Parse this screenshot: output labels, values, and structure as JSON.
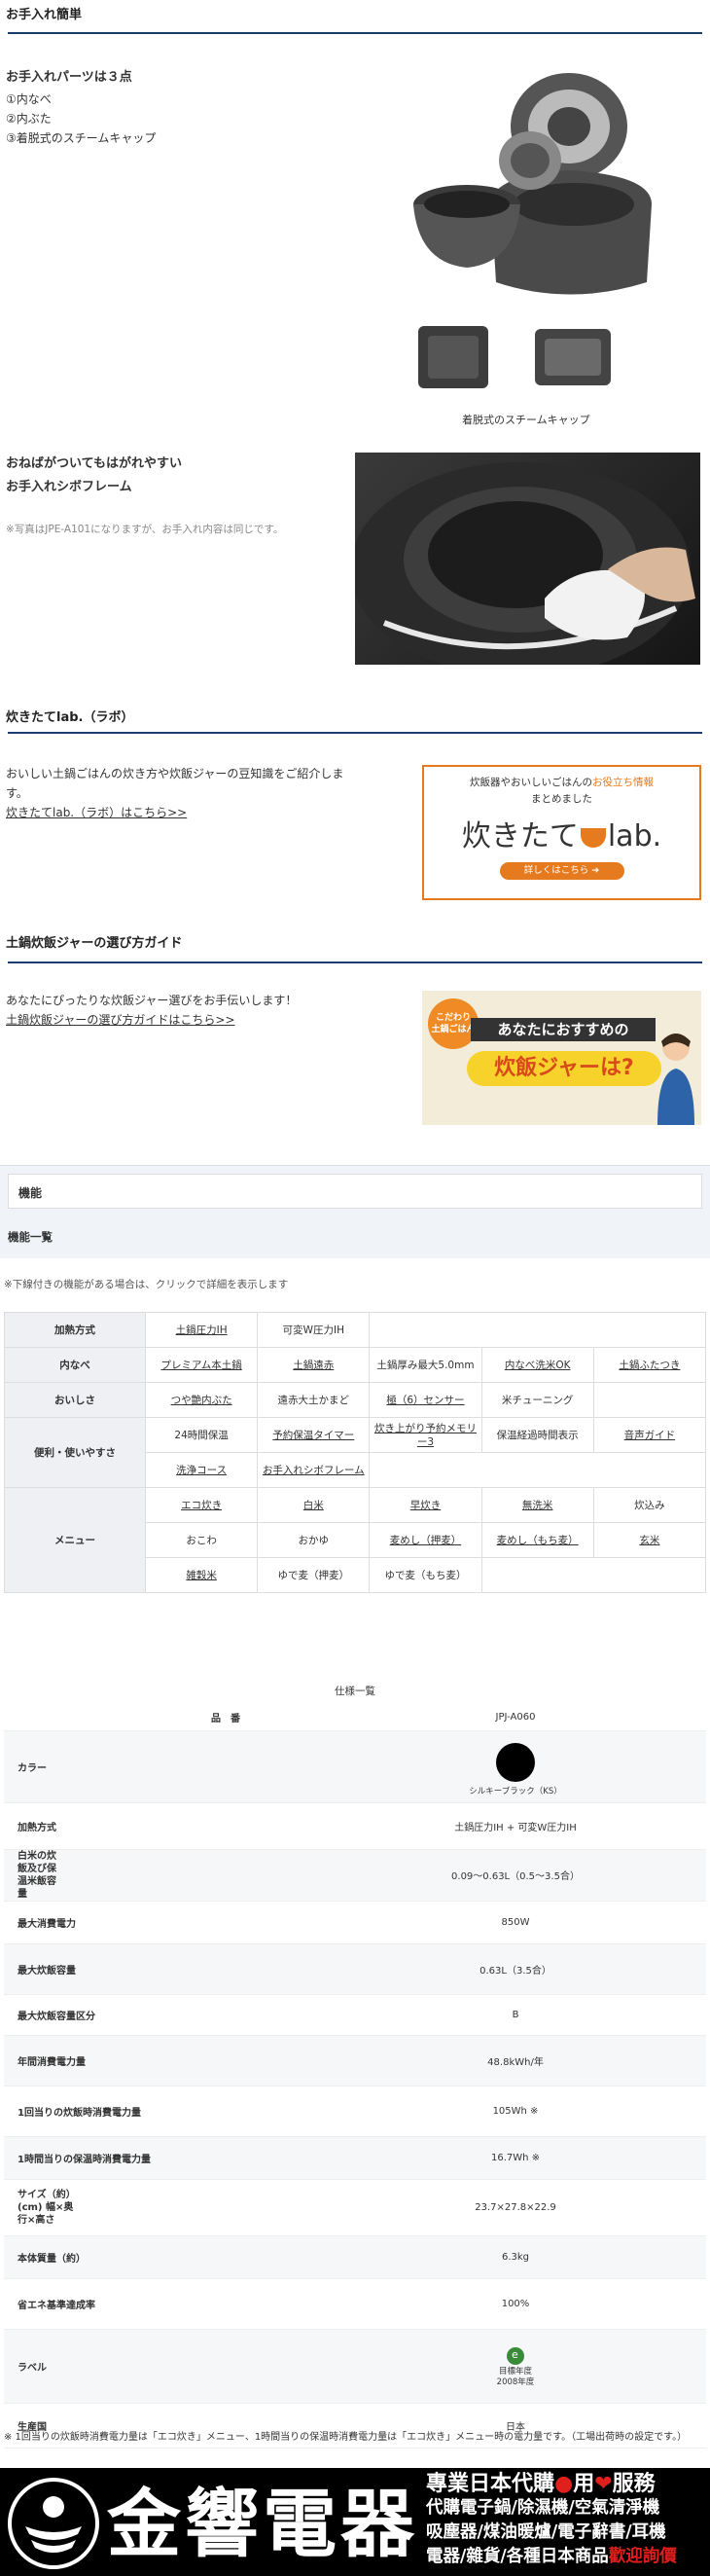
{
  "section1": {
    "title": "お手入れ簡単",
    "parts_head": "お手入れパーツは３点",
    "parts": [
      "①内なべ",
      "②内ぶた",
      "③着脱式のスチームキャップ"
    ],
    "caption": "着脱式のスチームキャップ"
  },
  "section2": {
    "head_line1": "おねばがついてもはがれやすい",
    "head_line2": "お手入れシボフレーム",
    "note": "※写真はJPE-A101になりますが、お手入れ内容は同じです。"
  },
  "section3": {
    "title": "炊きたてlab.（ラボ）",
    "text": "おいしい土鍋ごはんの炊き方や炊飯ジャーの豆知識をご紹介します。",
    "link": "炊きたてlab.（ラボ）はこちら>>",
    "banner_line1": "炊飯器やおいしいごはんの",
    "banner_highlight": "お役立ち情報",
    "banner_line2": "まとめました",
    "banner_logo": "炊きたて",
    "banner_logo_tail": "lab.",
    "banner_button": "詳しくはこちら"
  },
  "section4": {
    "title": "土鍋炊飯ジャーの選び方ガイド",
    "text": "あなたにぴったりな炊飯ジャー選びをお手伝いします！",
    "link": "土鍋炊飯ジャーの選び方ガイドはこちら>>",
    "banner_badge_line1": "こだわり",
    "banner_badge_line2": "土鍋ごはん",
    "banner_line1": "あなたにおすすめの",
    "banner_line2": "炊飯ジャーは?"
  },
  "function": {
    "bar_title": "機能",
    "sub_title": "機能一覧",
    "note": "※下線付きの機能がある場合は、クリックで詳細を表示します",
    "rows": [
      {
        "head": "加熱方式",
        "cells": [
          [
            "土鍋圧力IH",
            true
          ],
          [
            "可変W圧力IH",
            false
          ]
        ]
      },
      {
        "head": "内なべ",
        "cells": [
          [
            "プレミアム本土鍋",
            true
          ],
          [
            "土鍋遠赤",
            true
          ],
          [
            "土鍋厚み最大5.0mm",
            false
          ],
          [
            "内なべ洗米OK",
            true
          ],
          [
            "土鍋ふたつき",
            true
          ]
        ]
      },
      {
        "head": "おいしさ",
        "cells": [
          [
            "つや艶内ぶた",
            true
          ],
          [
            "遠赤大土かまど",
            false
          ],
          [
            "極（6）センサー",
            true
          ],
          [
            "米チューニング",
            false
          ]
        ]
      },
      {
        "head": "便利・使いやすさ",
        "cells": [
          [
            "24時間保温",
            false
          ],
          [
            "予約保温タイマー",
            true
          ],
          [
            "炊き上がり予約メモリー3",
            true
          ],
          [
            "保温経過時間表示",
            false
          ],
          [
            "音声ガイド",
            true
          ]
        ],
        "cells2": [
          [
            "洗浄コース",
            true
          ],
          [
            "お手入れシボフレーム",
            true
          ]
        ]
      },
      {
        "head": "メニュー",
        "cells": [
          [
            "エコ炊き",
            true
          ],
          [
            "白米",
            true
          ],
          [
            "早炊き",
            true
          ],
          [
            "無洗米",
            true
          ],
          [
            "炊込み",
            false
          ]
        ],
        "cells2": [
          [
            "おこわ",
            false
          ],
          [
            "おかゆ",
            false
          ],
          [
            "麦めし（押麦）",
            true
          ],
          [
            "麦めし（もち麦）",
            true
          ],
          [
            "玄米",
            true
          ]
        ],
        "cells3": [
          [
            "雑穀米",
            true
          ],
          [
            "ゆで麦（押麦）",
            false
          ],
          [
            "ゆで麦（もち麦）",
            false
          ]
        ]
      }
    ]
  },
  "spec": {
    "title": "仕様一覧",
    "rows": [
      {
        "k": "品　番",
        "v": "JPJ-A060"
      },
      {
        "k": "カラー",
        "v": "シルキーブラック（KS）",
        "dot": true
      },
      {
        "k": "加熱方式",
        "v": "土鍋圧力IH + 可変W圧力IH"
      },
      {
        "k": "白米の炊飯及び保温米飯容量",
        "v": "0.09〜0.63L（0.5〜3.5合）"
      },
      {
        "k": "最大消費電力",
        "v": "850W"
      },
      {
        "k": "最大炊飯容量",
        "v": "0.63L（3.5合）"
      },
      {
        "k": "最大炊飯容量区分",
        "v": "B"
      },
      {
        "k": "年間消費電力量",
        "v": "48.8kWh/年"
      },
      {
        "k": "1回当りの炊飯時消費電力量",
        "v": "105Wh ※"
      },
      {
        "k": "1時間当りの保温時消費電力量",
        "v": "16.7Wh ※"
      },
      {
        "k": "サイズ（約）(cm) 幅×奥行×高さ",
        "v": "23.7×27.8×22.9"
      },
      {
        "k": "本体質量（約）",
        "v": "6.3kg"
      },
      {
        "k": "省エネ基準達成率",
        "v": "100%"
      },
      {
        "k": "ラベル",
        "v": "目標年度2008年度",
        "leaf": true
      },
      {
        "k": "生産国",
        "v": "日本"
      }
    ],
    "footnote": "※ 1回当りの炊飯時消費電力量は「エコ炊き」メニュー、1時間当りの保温時消費電力量は「エコ炊き」メニュー時の電力量です。（工場出荷時の設定です。）"
  },
  "shop": {
    "name": "金響電器",
    "tag_line1_a": "專業日本代購",
    "tag_line1_b": "用",
    "tag_line1_c": "服務",
    "tag_line2": "代購電子鍋/除濕機/空氣清淨機",
    "tag_line3": "吸塵器/煤油暖爐/電子辭書/耳機",
    "tag_line4_a": "電器/雜貨/各種日本商品",
    "tag_line4_b": "歡迎詢價"
  }
}
